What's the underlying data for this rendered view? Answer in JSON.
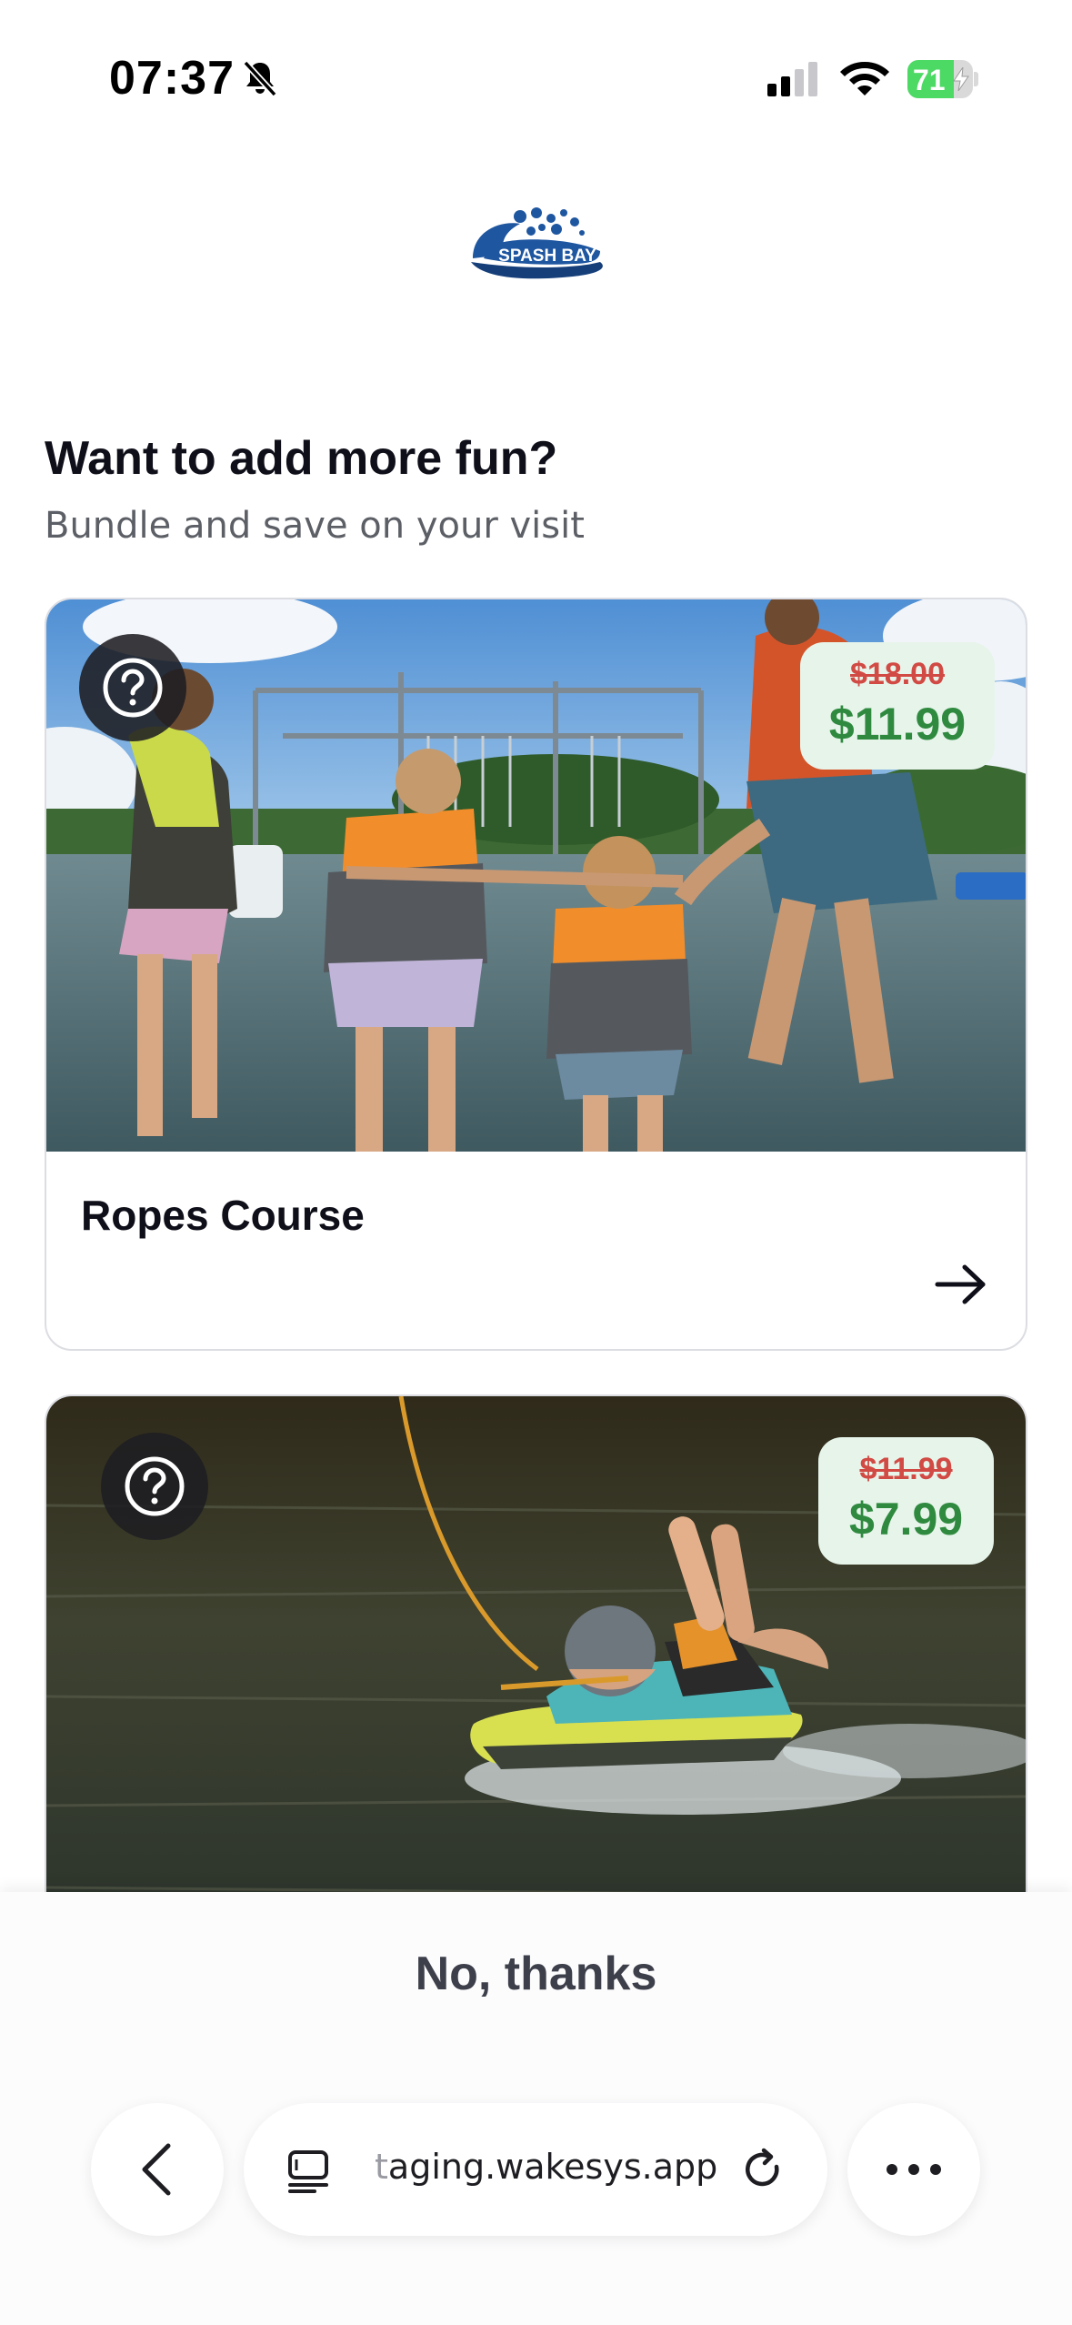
{
  "status_bar": {
    "time": "07:37",
    "battery_level": "71",
    "battery_fraction": 0.71,
    "icons": [
      "bell-slash-icon",
      "signal-icon",
      "wifi-icon",
      "battery-icon"
    ]
  },
  "logo": {
    "text": "SPASH BAY",
    "colors": {
      "primary": "#1e56a0",
      "dark": "#163f7a"
    }
  },
  "header": {
    "title": "Want to add more fun?",
    "subtitle": "Bundle and save on your visit"
  },
  "offers": [
    {
      "title": "Ropes Course",
      "old_price": "$18.00",
      "new_price": "$11.99",
      "icon": "question-icon",
      "action_icon": "arrow-right-icon"
    },
    {
      "title": "",
      "old_price": "$11.99",
      "new_price": "$7.99",
      "icon": "question-icon"
    }
  ],
  "footer": {
    "decline_label": "No, thanks"
  },
  "browser": {
    "url_prefix": "t",
    "url_rest": "aging.wakesys.app",
    "icons": [
      "chevron-left-icon",
      "tabs-icon",
      "reload-icon",
      "more-icon"
    ]
  },
  "colors": {
    "old_price": "#d24a44",
    "new_price": "#2f8a3f",
    "price_badge_bg": "#e6f4ea",
    "text_primary": "#0f0f1a",
    "text_secondary": "#5c5f66"
  }
}
